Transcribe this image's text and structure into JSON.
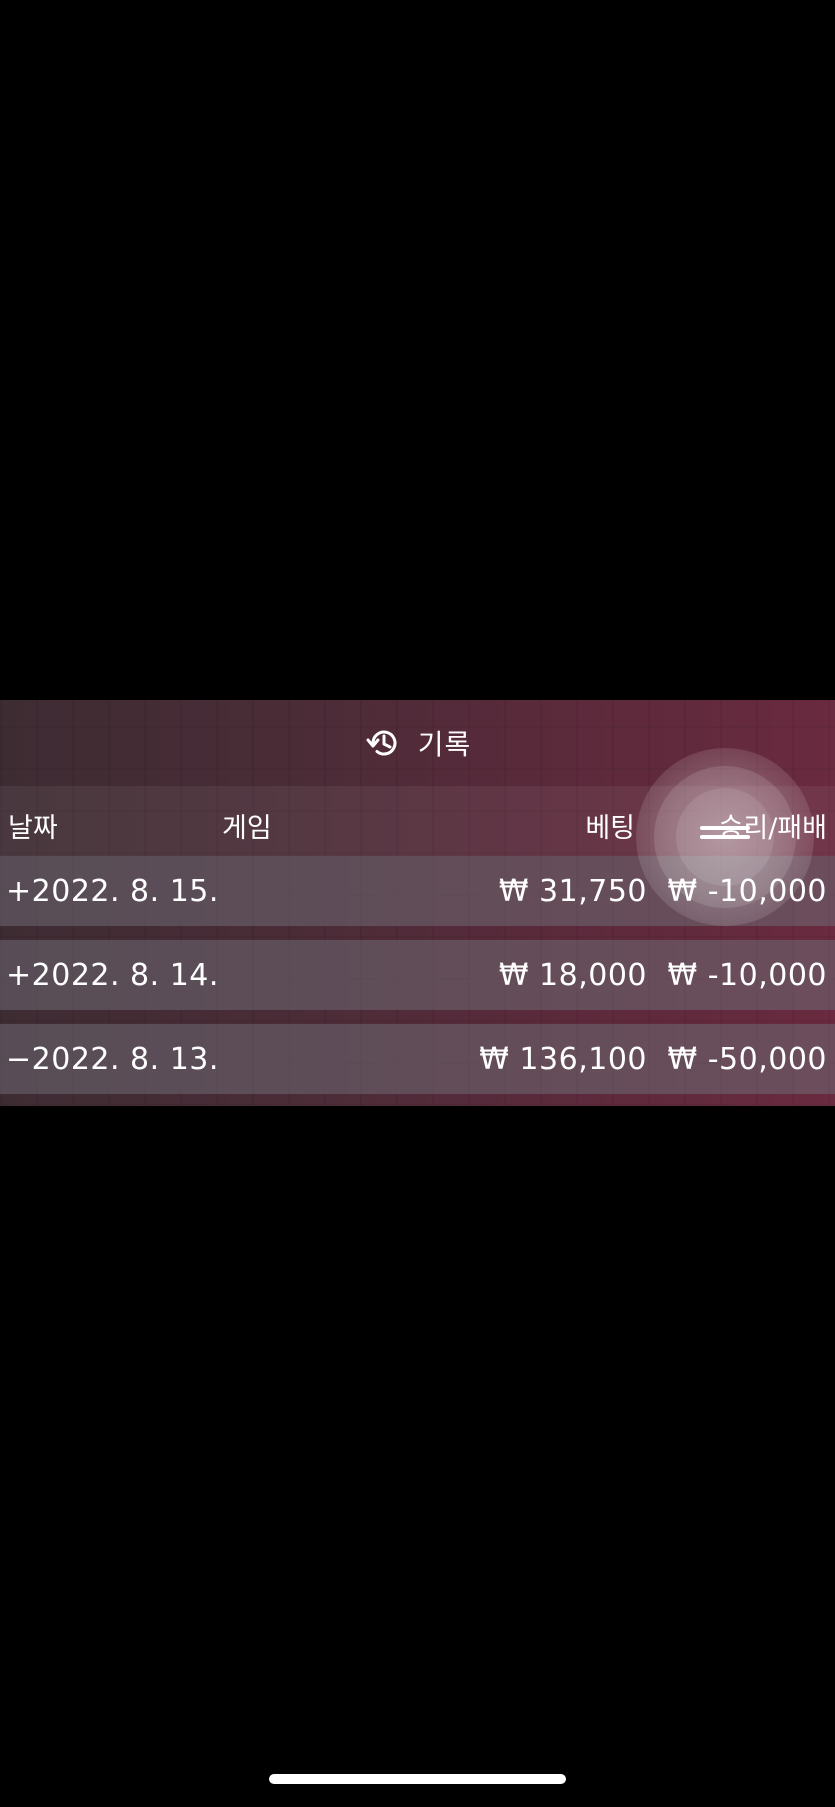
{
  "panel": {
    "title": "기록",
    "title_icon": "history-icon"
  },
  "columns": {
    "date": "날짜",
    "game": "게임",
    "bet": "베팅",
    "result": "승리/패배"
  },
  "rows": [
    {
      "expand": "+",
      "date": "2022. 8. 15.",
      "bet": "₩ 31,750",
      "result": "₩ -10,000"
    },
    {
      "expand": "+",
      "date": "2022. 8. 14.",
      "bet": "₩ 18,000",
      "result": "₩ -10,000"
    },
    {
      "expand": "−",
      "date": "2022. 8. 13.",
      "bet": "₩ 136,100",
      "result": "₩ -50,000"
    }
  ],
  "colors": {
    "background": "#000000",
    "panel": "#4a2c37",
    "row": "#6e6973",
    "text": "#ffffff"
  }
}
